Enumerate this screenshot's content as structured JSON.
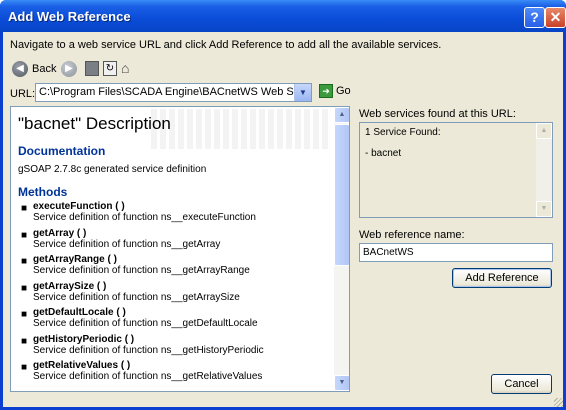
{
  "window": {
    "title": "Add Web Reference",
    "help_glyph": "?",
    "close_glyph": "✕"
  },
  "intro_text": "Navigate to a web service URL and click Add Reference to add all the available services.",
  "toolbar": {
    "back_label": "Back",
    "back_icon": "back-arrow-icon",
    "forward_icon": "forward-arrow-icon",
    "stop_icon": "stop-icon",
    "refresh_icon": "refresh-icon",
    "home_icon": "home-icon"
  },
  "url": {
    "label": "URL:",
    "value": "C:\\Program Files\\SCADA Engine\\BACnetWS Web Service\\bacnet.v",
    "go_label": "Go"
  },
  "description": {
    "title": "\"bacnet\" Description",
    "documentation_heading": "Documentation",
    "documentation_text": "gSOAP 2.7.8c generated service definition",
    "methods_heading": "Methods",
    "methods": [
      {
        "name": "executeFunction ( )",
        "def": "Service definition of function ns__executeFunction"
      },
      {
        "name": "getArray ( )",
        "def": "Service definition of function ns__getArray"
      },
      {
        "name": "getArrayRange ( )",
        "def": "Service definition of function ns__getArrayRange"
      },
      {
        "name": "getArraySize ( )",
        "def": "Service definition of function ns__getArraySize"
      },
      {
        "name": "getDefaultLocale ( )",
        "def": "Service definition of function ns__getDefaultLocale"
      },
      {
        "name": "getHistoryPeriodic ( )",
        "def": "Service definition of function ns__getHistoryPeriodic"
      },
      {
        "name": "getRelativeValues ( )",
        "def": "Service definition of function ns__getRelativeValues"
      }
    ]
  },
  "found": {
    "label": "Web services found at this URL:",
    "line1": "1 Service Found:",
    "line2": "- bacnet"
  },
  "reference": {
    "label": "Web reference name:",
    "value": "BACnetWS"
  },
  "buttons": {
    "add_reference": "Add Reference",
    "cancel": "Cancel"
  },
  "colors": {
    "titlebar": "#0a4cd8",
    "dialog_bg": "#ece9d8",
    "heading_blue": "#003399"
  }
}
